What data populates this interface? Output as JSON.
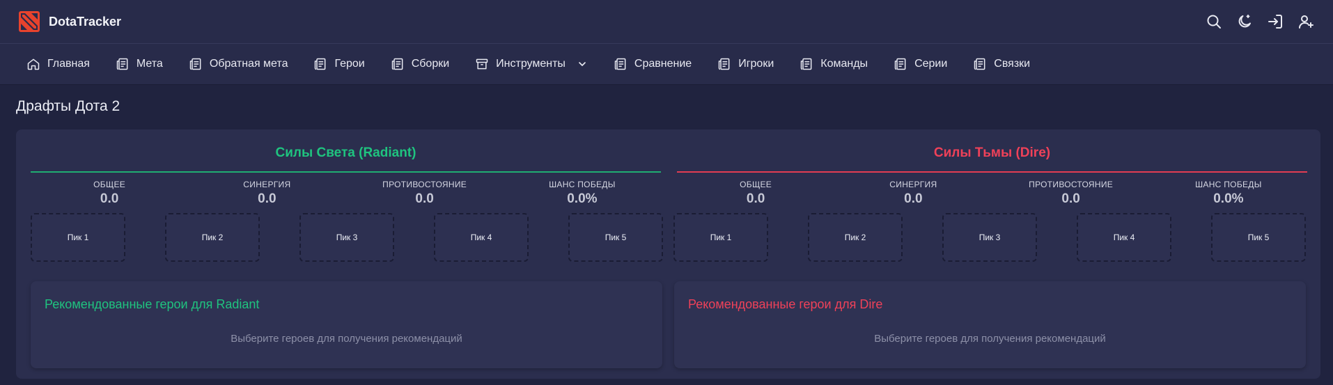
{
  "app": {
    "brand": "DotaTracker"
  },
  "nav": {
    "items": [
      {
        "label": "Главная",
        "icon": "home-icon"
      },
      {
        "label": "Мета",
        "icon": "newspaper-icon"
      },
      {
        "label": "Обратная мета",
        "icon": "newspaper-icon"
      },
      {
        "label": "Герои",
        "icon": "newspaper-icon"
      },
      {
        "label": "Сборки",
        "icon": "newspaper-icon"
      },
      {
        "label": "Инструменты",
        "icon": "archive-icon",
        "dropdown": true
      },
      {
        "label": "Сравнение",
        "icon": "newspaper-icon"
      },
      {
        "label": "Игроки",
        "icon": "newspaper-icon"
      },
      {
        "label": "Команды",
        "icon": "newspaper-icon"
      },
      {
        "label": "Серии",
        "icon": "newspaper-icon"
      },
      {
        "label": "Связки",
        "icon": "newspaper-icon"
      }
    ]
  },
  "page": {
    "title": "Драфты Дота 2"
  },
  "radiant": {
    "title": "Силы Света (Radiant)",
    "stats": [
      {
        "label": "ОБЩЕЕ",
        "value": "0.0"
      },
      {
        "label": "СИНЕРГИЯ",
        "value": "0.0"
      },
      {
        "label": "ПРОТИВОСТОЯНИЕ",
        "value": "0.0"
      },
      {
        "label": "ШАНС ПОБЕДЫ",
        "value": "0.0%"
      }
    ],
    "picks": [
      "Пик 1",
      "Пик 2",
      "Пик 3",
      "Пик 4",
      "Пик 5"
    ],
    "rec_title": "Рекомендованные герои для Radiant",
    "rec_hint": "Выберите героев для получения рекомендаций"
  },
  "dire": {
    "title": "Силы Тьмы (Dire)",
    "stats": [
      {
        "label": "ОБЩЕЕ",
        "value": "0.0"
      },
      {
        "label": "СИНЕРГИЯ",
        "value": "0.0"
      },
      {
        "label": "ПРОТИВОСТОЯНИЕ",
        "value": "0.0"
      },
      {
        "label": "ШАНС ПОБЕДЫ",
        "value": "0.0%"
      }
    ],
    "picks": [
      "Пик 1",
      "Пик 2",
      "Пик 3",
      "Пик 4",
      "Пик 5"
    ],
    "rec_title": "Рекомендованные герои для Dire",
    "rec_hint": "Выберите героев для получения рекомендаций"
  },
  "colors": {
    "radiant": "#1fc37f",
    "dire": "#ef4159",
    "background": "#20233f",
    "header": "#282b4a",
    "panel": "#2b2e4e",
    "logo": "#e8432d"
  },
  "top_icons": [
    "search-icon",
    "moon-icon",
    "login-icon",
    "add-user-icon"
  ]
}
